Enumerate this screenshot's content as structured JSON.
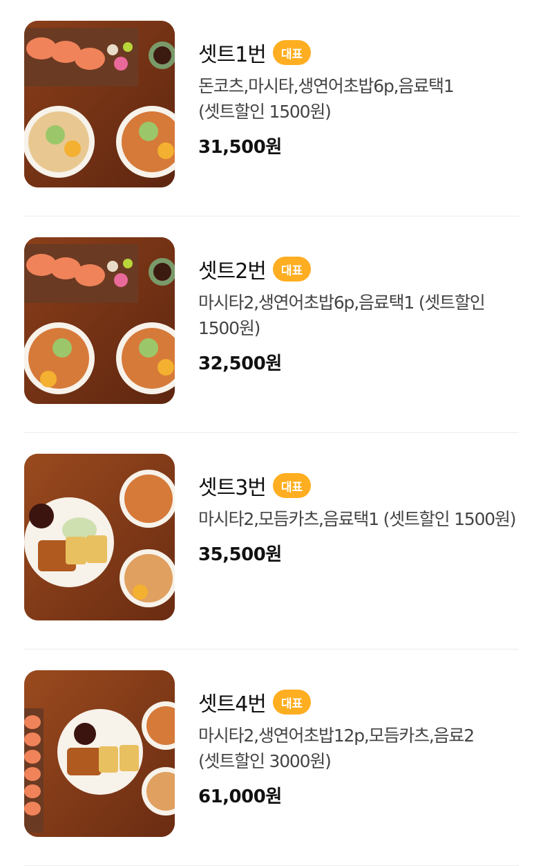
{
  "menu": {
    "items": [
      {
        "title": "셋트1번",
        "badge": "대표",
        "description": "돈코츠,마시타,생연어초밥6p,음료택1 (셋트할인 1500원)",
        "price": "31,500원",
        "image": "sushi-ramen-set-photo"
      },
      {
        "title": "셋트2번",
        "badge": "대표",
        "description": "마시타2,생연어초밥6p,음료택1 (셋트할인 1500원)",
        "price": "32,500원",
        "image": "sushi-ramen-set-photo"
      },
      {
        "title": "셋트3번",
        "badge": "대표",
        "description": "마시타2,모듬카츠,음료택1 (셋트할인 1500원)",
        "price": "35,500원",
        "image": "katsu-ramen-set-photo"
      },
      {
        "title": "셋트4번",
        "badge": "대표",
        "description": "마시타2,생연어초밥12p,모듬카츠,음료2 (셋트할인 3000원)",
        "price": "61,000원",
        "image": "sushi-katsu-ramen-set-photo"
      }
    ]
  },
  "colors": {
    "badge": "#ffae21",
    "divider": "#ececec",
    "wood": "#7a3a1a"
  }
}
